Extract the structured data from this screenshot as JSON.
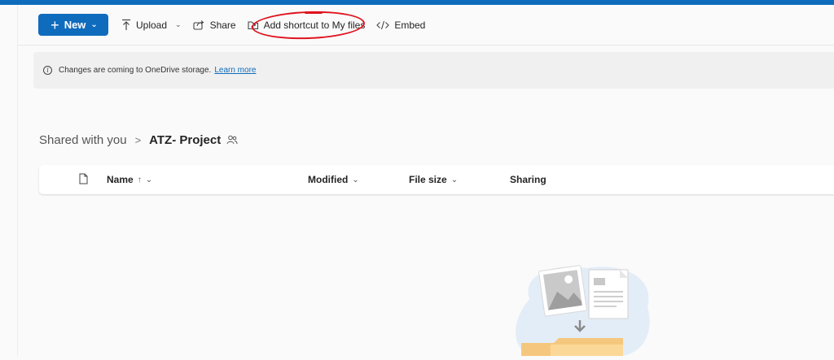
{
  "toolbar": {
    "new_label": "New",
    "upload_label": "Upload",
    "share_label": "Share",
    "add_shortcut_label": "Add shortcut to My files",
    "embed_label": "Embed"
  },
  "banner": {
    "message": "Changes are coming to OneDrive storage.",
    "link_text": "Learn more"
  },
  "breadcrumb": {
    "root": "Shared with you",
    "separator": ">",
    "current": "ATZ- Project"
  },
  "table": {
    "columns": {
      "name": "Name",
      "name_sort": "↑",
      "modified": "Modified",
      "file_size": "File size",
      "sharing": "Sharing"
    }
  },
  "colors": {
    "accent": "#0f6cbd",
    "annotation": "#e0141e"
  },
  "icons": [
    "plus-icon",
    "chevron-down-icon",
    "upload-icon",
    "share-icon",
    "shortcut-icon",
    "embed-icon",
    "info-icon",
    "people-icon",
    "file-icon"
  ]
}
